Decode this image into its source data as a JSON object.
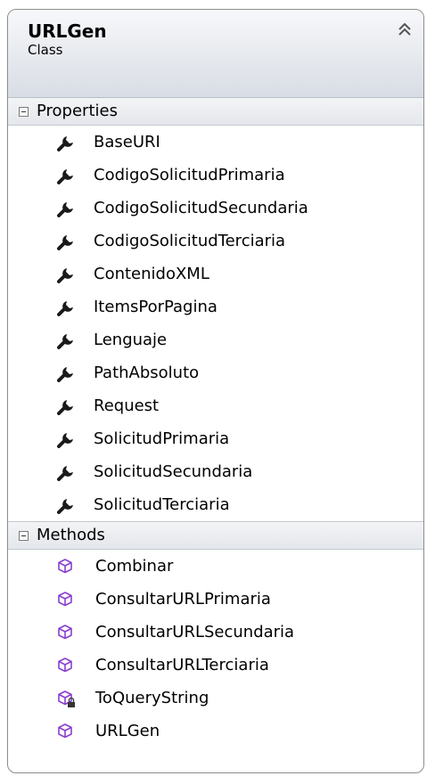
{
  "class_box": {
    "name": "URLGen",
    "stereotype": "Class"
  },
  "sections": {
    "properties": {
      "title": "Properties",
      "items": [
        {
          "label": "BaseURI",
          "icon": "wrench-property-icon"
        },
        {
          "label": "CodigoSolicitudPrimaria",
          "icon": "wrench-property-icon"
        },
        {
          "label": "CodigoSolicitudSecundaria",
          "icon": "wrench-property-icon"
        },
        {
          "label": "CodigoSolicitudTerciaria",
          "icon": "wrench-property-icon"
        },
        {
          "label": "ContenidoXML",
          "icon": "wrench-property-icon"
        },
        {
          "label": "ItemsPorPagina",
          "icon": "wrench-property-icon"
        },
        {
          "label": "Lenguaje",
          "icon": "wrench-property-icon"
        },
        {
          "label": "PathAbsoluto",
          "icon": "wrench-property-icon"
        },
        {
          "label": "Request",
          "icon": "wrench-property-icon"
        },
        {
          "label": "SolicitudPrimaria",
          "icon": "wrench-property-icon"
        },
        {
          "label": "SolicitudSecundaria",
          "icon": "wrench-property-icon"
        },
        {
          "label": "SolicitudTerciaria",
          "icon": "wrench-property-icon"
        }
      ]
    },
    "methods": {
      "title": "Methods",
      "items": [
        {
          "label": "Combinar",
          "icon": "method-cube-icon"
        },
        {
          "label": "ConsultarURLPrimaria",
          "icon": "method-cube-icon"
        },
        {
          "label": "ConsultarURLSecundaria",
          "icon": "method-cube-icon"
        },
        {
          "label": "ConsultarURLTerciaria",
          "icon": "method-cube-icon"
        },
        {
          "label": "ToQueryString",
          "icon": "private-method-cube-icon"
        },
        {
          "label": "URLGen",
          "icon": "method-cube-icon"
        }
      ]
    }
  },
  "colors": {
    "method_icon": "#8a3fd1",
    "property_icon": "#1a1a1a",
    "border": "#8c8c8c"
  }
}
